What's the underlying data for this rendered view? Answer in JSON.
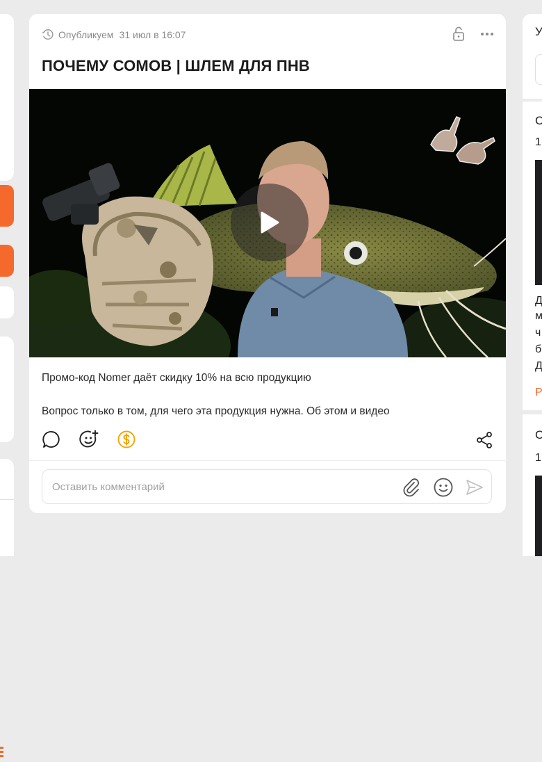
{
  "post": {
    "schedule_label": "Опубликуем",
    "schedule_date": "31 июл в 16:07",
    "title": "ПОЧЕМУ СОМОВ | ШЛЕМ ДЛЯ ПНВ",
    "text_line1": "Промо-код Nomer даёт скидку 10% на всю продукцию",
    "text_line2": "Вопрос только в том, для чего эта продукция нужна. Об этом и видео"
  },
  "comment": {
    "placeholder": "Оставить комментарий"
  },
  "right_column": {
    "header_char": "У",
    "post1_title_char": "С",
    "post1_num_char": "1",
    "post1_text_chars": [
      "Д",
      "м",
      "ч",
      "б",
      "Д"
    ],
    "post1_link_char": "Р",
    "post2_title_char": "С",
    "post2_num_char": "1"
  },
  "icons": {
    "clock": "clock-icon",
    "lock": "lock-icon",
    "more": "more-icon",
    "play": "play-icon",
    "comment": "comment-icon",
    "reaction": "add-reaction-icon",
    "donate": "donate-icon",
    "share": "share-icon",
    "attach": "paperclip-icon",
    "emoji": "emoji-icon",
    "send": "send-icon"
  },
  "colors": {
    "accent": "#f56a2c",
    "donate": "#f0a500",
    "muted": "#8a8a8a"
  }
}
